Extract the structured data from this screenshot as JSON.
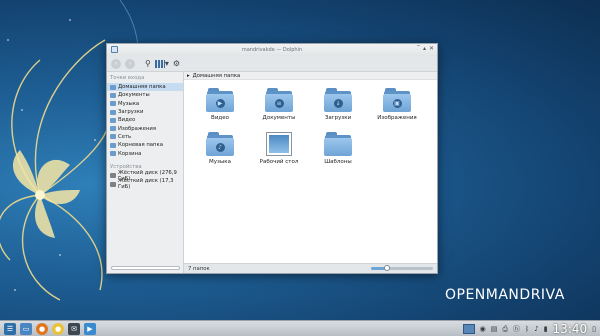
{
  "window": {
    "title": "mandrivakde — Dolphin",
    "controls": {
      "minimize": "‾",
      "maximize": "▴",
      "close": "✕"
    }
  },
  "toolbar": {
    "back_icon": "‹",
    "forward_icon": "›",
    "search_icon": "⚲",
    "view_icon": "▾",
    "settings_icon": "⚙"
  },
  "places": {
    "header": "Точки входа",
    "items": [
      {
        "label": "Домашняя папка"
      },
      {
        "label": "Документы"
      },
      {
        "label": "Музыка"
      },
      {
        "label": "Загрузки"
      },
      {
        "label": "Видео"
      },
      {
        "label": "Изображения"
      },
      {
        "label": "Сеть"
      },
      {
        "label": "Корневая папка"
      },
      {
        "label": "Корзина"
      }
    ],
    "devices_header": "Устройства",
    "devices": [
      {
        "label": "Жёсткий диск (276,9 ГиБ)"
      },
      {
        "label": "Жёсткий диск (17,3 ГиБ)"
      }
    ]
  },
  "breadcrumb": {
    "arrow": "▸",
    "label": "Домашняя папка"
  },
  "folders": [
    {
      "label": "Видео",
      "emblem": "▶"
    },
    {
      "label": "Документы",
      "emblem": "≡"
    },
    {
      "label": "Загрузки",
      "emblem": "↓"
    },
    {
      "label": "Изображения",
      "emblem": "▣"
    },
    {
      "label": "Музыка",
      "emblem": "♪"
    },
    {
      "label": "Рабочий стол",
      "emblem": ""
    },
    {
      "label": "Шаблоны",
      "emblem": ""
    }
  ],
  "status": {
    "text": "7 папок",
    "zoom_fraction": 0.25
  },
  "brand": "OPENMANDRIVA",
  "taskbar": {
    "clock": "13:40"
  },
  "colors": {
    "accent": "#6fa4d6",
    "selection": "#c6dcf1"
  }
}
